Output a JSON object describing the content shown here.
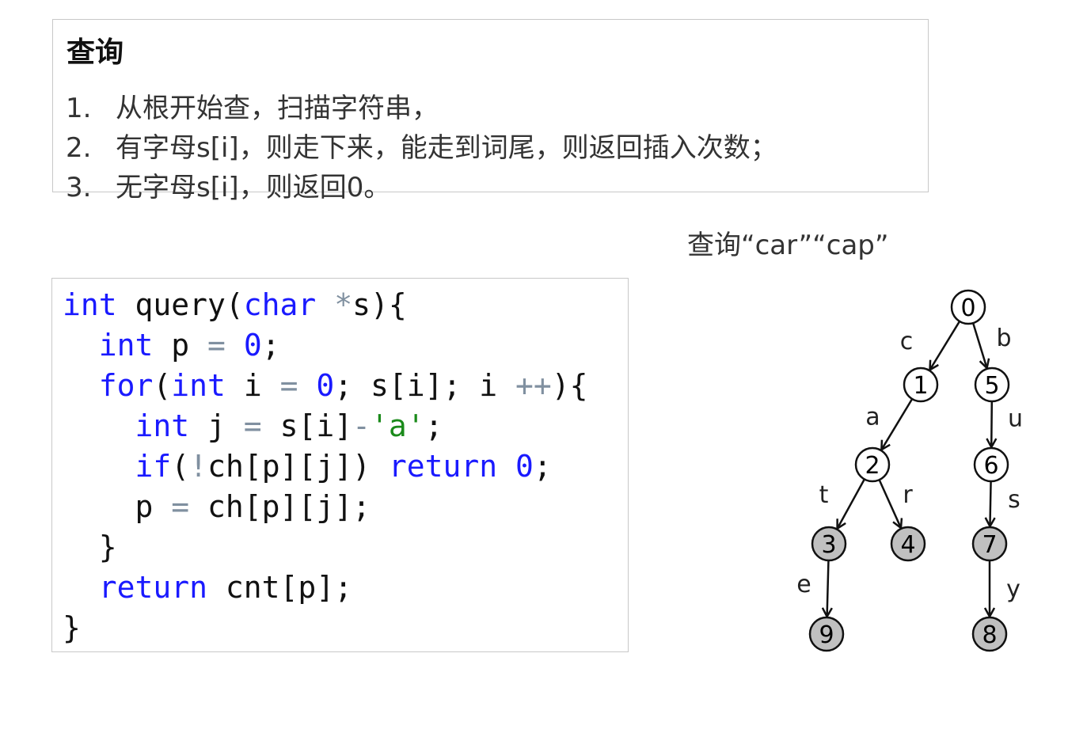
{
  "query_box": {
    "title": "查询",
    "items": [
      {
        "num": "1.",
        "text": "从根开始查，扫描字符串，"
      },
      {
        "num": "2.",
        "text": "有字母s[i]，则走下来，能走到词尾，则返回插入次数；"
      },
      {
        "num": "3.",
        "text": "无字母s[i]，则返回0。"
      }
    ]
  },
  "caption": "查询“car”“cap”",
  "code": [
    [
      [
        "kw",
        "int"
      ],
      [
        "pl",
        " query("
      ],
      [
        "kw",
        "char"
      ],
      [
        "pl",
        " "
      ],
      [
        "op",
        "*"
      ],
      [
        "pl",
        "s){"
      ]
    ],
    [
      [
        "pl",
        "  "
      ],
      [
        "kw",
        "int"
      ],
      [
        "pl",
        " p "
      ],
      [
        "op",
        "="
      ],
      [
        "pl",
        " "
      ],
      [
        "num-t",
        "0"
      ],
      [
        "pl",
        ";"
      ]
    ],
    [
      [
        "pl",
        "  "
      ],
      [
        "kw",
        "for"
      ],
      [
        "pl",
        "("
      ],
      [
        "kw",
        "int"
      ],
      [
        "pl",
        " i "
      ],
      [
        "op",
        "="
      ],
      [
        "pl",
        " "
      ],
      [
        "num-t",
        "0"
      ],
      [
        "pl",
        "; s[i]; i "
      ],
      [
        "op",
        "++"
      ],
      [
        "pl",
        "){"
      ]
    ],
    [
      [
        "pl",
        "    "
      ],
      [
        "kw",
        "int"
      ],
      [
        "pl",
        " j "
      ],
      [
        "op",
        "="
      ],
      [
        "pl",
        " s[i]"
      ],
      [
        "op",
        "-"
      ],
      [
        "str",
        "'a'"
      ],
      [
        "pl",
        ";"
      ]
    ],
    [
      [
        "pl",
        "    "
      ],
      [
        "kw",
        "if"
      ],
      [
        "pl",
        "("
      ],
      [
        "op",
        "!"
      ],
      [
        "pl",
        "ch[p][j]) "
      ],
      [
        "kw",
        "return"
      ],
      [
        "pl",
        " "
      ],
      [
        "num-t",
        "0"
      ],
      [
        "pl",
        ";"
      ]
    ],
    [
      [
        "pl",
        "    p "
      ],
      [
        "op",
        "="
      ],
      [
        "pl",
        " ch[p][j];"
      ]
    ],
    [
      [
        "pl",
        "  }"
      ]
    ],
    [
      [
        "pl",
        "  "
      ],
      [
        "kw",
        "return"
      ],
      [
        "pl",
        " cnt[p];"
      ]
    ],
    [
      [
        "pl",
        "}"
      ]
    ]
  ],
  "trie": {
    "nodes": [
      {
        "id": "0",
        "end": false
      },
      {
        "id": "1",
        "end": false
      },
      {
        "id": "5",
        "end": false
      },
      {
        "id": "2",
        "end": false
      },
      {
        "id": "6",
        "end": false
      },
      {
        "id": "3",
        "end": true
      },
      {
        "id": "4",
        "end": true
      },
      {
        "id": "7",
        "end": true
      },
      {
        "id": "9",
        "end": true
      },
      {
        "id": "8",
        "end": true
      }
    ],
    "edges": [
      {
        "from": "0",
        "to": "1",
        "label": "c"
      },
      {
        "from": "0",
        "to": "5",
        "label": "b"
      },
      {
        "from": "1",
        "to": "2",
        "label": "a"
      },
      {
        "from": "5",
        "to": "6",
        "label": "u"
      },
      {
        "from": "2",
        "to": "3",
        "label": "t"
      },
      {
        "from": "2",
        "to": "4",
        "label": "r"
      },
      {
        "from": "6",
        "to": "7",
        "label": "s"
      },
      {
        "from": "3",
        "to": "9",
        "label": "e"
      },
      {
        "from": "7",
        "to": "8",
        "label": "y"
      }
    ],
    "colors": {
      "end_fill": "#c0c0c0",
      "node_fill": "#ffffff",
      "stroke": "#111111"
    }
  }
}
